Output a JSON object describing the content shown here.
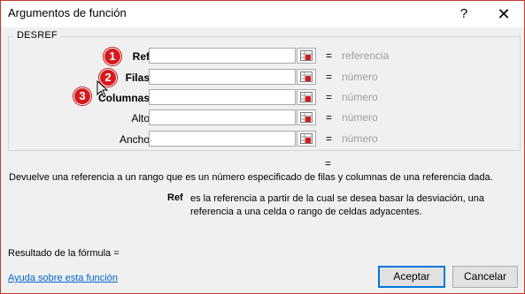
{
  "window": {
    "title": "Argumentos de función",
    "help_glyph": "?",
    "close_glyph": "✕"
  },
  "group": {
    "label": "DESREF"
  },
  "args": [
    {
      "label": "Ref",
      "value": "",
      "eq": "=",
      "hint": "referencia",
      "badge": "1"
    },
    {
      "label": "Filas",
      "value": "",
      "eq": "=",
      "hint": "número",
      "badge": "2"
    },
    {
      "label": "Columnas",
      "value": "",
      "eq": "=",
      "hint": "número",
      "badge": "3"
    },
    {
      "label": "Alto",
      "value": "",
      "eq": "=",
      "hint": "número"
    },
    {
      "label": "Ancho",
      "value": "",
      "eq": "=",
      "hint": "número"
    }
  ],
  "result_eq": "=",
  "description": "Devuelve una referencia a un rango que es un número especificado de filas y columnas de una referencia dada.",
  "arg_description": {
    "name": "Ref",
    "text": "es la referencia a partir de la cual se desea basar la desviación, una referencia a una celda o rango de celdas adyacentes."
  },
  "result_label": "Resultado de la fórmula =",
  "help_link": "Ayuda sobre esta función",
  "buttons": {
    "ok": "Aceptar",
    "cancel": "Cancelar"
  },
  "colors": {
    "badge": "#d7191c",
    "hint": "#a0a0a0",
    "link": "#0066cc",
    "accent": "#0078d7"
  }
}
